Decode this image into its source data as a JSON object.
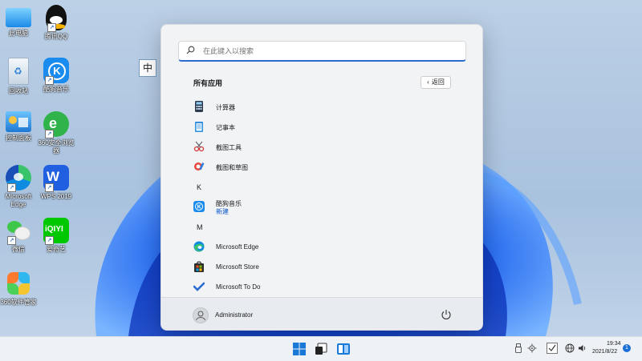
{
  "desktop": {
    "icons": [
      {
        "label": "此电脑",
        "icon": "computer-icon"
      },
      {
        "label": "腾讯QQ",
        "icon": "qq-penguin-icon"
      },
      {
        "label": "回收站",
        "icon": "recycle-bin-icon"
      },
      {
        "label": "酷狗音乐",
        "icon": "kugou-icon"
      },
      {
        "label": "控制面板",
        "icon": "control-panel-icon"
      },
      {
        "label": "360安全浏览器",
        "icon": "360-browser-icon"
      },
      {
        "label": "Microsoft Edge",
        "icon": "edge-icon"
      },
      {
        "label": "WPS 2019",
        "icon": "wps-icon"
      },
      {
        "label": "微信",
        "icon": "wechat-icon"
      },
      {
        "label": "爱奇艺",
        "icon": "iqiyi-icon"
      },
      {
        "label": "360软件管家",
        "icon": "360-software-icon"
      }
    ],
    "ime_indicator": "中"
  },
  "start_menu": {
    "search_placeholder": "在此键入以搜索",
    "all_apps_title": "所有应用",
    "back_label": "返回",
    "apps": [
      {
        "name": "计算器",
        "icon": "calculator-icon"
      },
      {
        "name": "记事本",
        "icon": "notepad-icon"
      },
      {
        "name": "截图工具",
        "icon": "snipping-tool-icon"
      },
      {
        "name": "截图和草图",
        "icon": "snip-sketch-icon"
      }
    ],
    "letter_k": "K",
    "kugou": {
      "name": "酷狗音乐",
      "subtitle": "新建",
      "icon": "kugou-icon"
    },
    "letter_m": "M",
    "apps_m": [
      {
        "name": "Microsoft Edge",
        "icon": "edge-icon"
      },
      {
        "name": "Microsoft Store",
        "icon": "store-icon"
      },
      {
        "name": "Microsoft To Do",
        "icon": "todo-check-icon"
      }
    ],
    "user_name": "Administrator"
  },
  "taskbar": {
    "time": "19:34",
    "date": "2021/8/22",
    "notification_count": "1"
  },
  "colors": {
    "accent": "#1a6fd6",
    "menu_bg": "#f2f3f5",
    "taskbar_bg": "#eef1f5"
  }
}
